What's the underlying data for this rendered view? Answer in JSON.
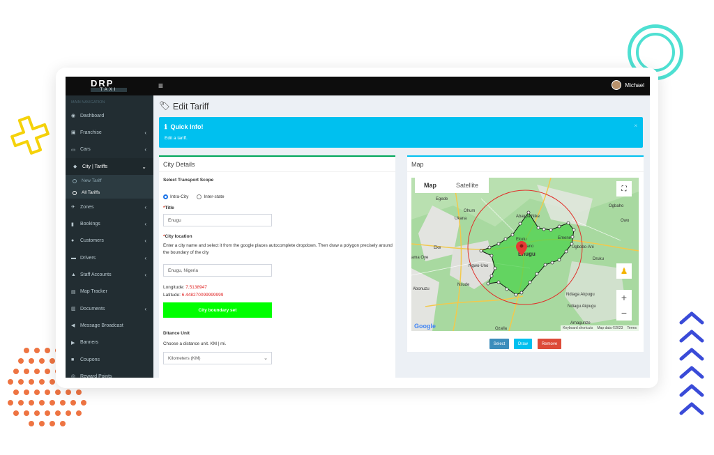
{
  "app": {
    "brand": "DRP",
    "brand_sub": "TAXI",
    "user_name": "Michael"
  },
  "sidebar": {
    "heading": "MAIN NAVIGATION",
    "items": [
      {
        "label": "Dashboard",
        "icon": "dashboard-icon",
        "chevron": ""
      },
      {
        "label": "Franchise",
        "icon": "briefcase-icon",
        "chevron": "‹"
      },
      {
        "label": "Cars",
        "icon": "car-icon",
        "chevron": "‹"
      },
      {
        "label": "City | Tariffs",
        "icon": "tags-icon",
        "chevron": "⌄"
      }
    ],
    "subitems": [
      {
        "label": "New Tariff"
      },
      {
        "label": "All Tariffs"
      }
    ],
    "items2": [
      {
        "label": "Zones",
        "icon": "plane-icon",
        "chevron": "‹"
      },
      {
        "label": "Bookings",
        "icon": "bookmark-icon",
        "chevron": "‹"
      },
      {
        "label": "Customers",
        "icon": "users-icon",
        "chevron": "‹"
      },
      {
        "label": "Drivers",
        "icon": "truck-icon",
        "chevron": "‹"
      },
      {
        "label": "Staff Accounts",
        "icon": "user-icon",
        "chevron": "‹"
      },
      {
        "label": "Map Tracker",
        "icon": "map-icon",
        "chevron": ""
      },
      {
        "label": "Documents",
        "icon": "book-icon",
        "chevron": "‹"
      },
      {
        "label": "Message Broadcast",
        "icon": "bullhorn-icon",
        "chevron": ""
      },
      {
        "label": "Banners",
        "icon": "flag-icon",
        "chevron": ""
      },
      {
        "label": "Coupons",
        "icon": "gift-icon",
        "chevron": ""
      },
      {
        "label": "Reward Points",
        "icon": "globe-icon",
        "chevron": ""
      }
    ]
  },
  "page": {
    "title": "Edit Tariff"
  },
  "info": {
    "title": "Quick Info!",
    "text": "Edit a tariff."
  },
  "city": {
    "title": "City Details",
    "scope_label": "Select Transport Scope",
    "scope_options": [
      "Intra-City",
      "Inter-state"
    ],
    "title_label": "Title",
    "title_value": "Enugu",
    "loc_label": "City location",
    "loc_help": "Enter a city name and select it from the google places autocomplete dropdown. Then draw a polygon precisely around the boundary of the city",
    "loc_value": "Enugu, Nigeria",
    "longitude_label": "Longitude:",
    "longitude": "7.5138947",
    "latitude_label": "Latitude:",
    "latitude": "6.448270099999999",
    "boundary_button": "City boundary set",
    "unit_label": "Ditance Unit",
    "unit_help": "Choose a distance unit. KM | mi.",
    "unit_value": "Kilometers (KM)"
  },
  "map": {
    "title": "Map",
    "mode_map": "Map",
    "mode_sat": "Satellite",
    "places": [
      "Egede",
      "Ohum",
      "Ukana",
      "Abakpa Nike",
      "Ogbaho",
      "Owo",
      "Ekulu",
      "Okinano",
      "Emene",
      "Ugbobo-Ani",
      "Enugu",
      "Druku",
      "Eke",
      "Ngwo-Uno",
      "ama Oye",
      "Nsude",
      "Abonuzu",
      "Ndiaga Akpugu",
      "Ozalla",
      "Amagunze",
      "Ndiagu Akpugu"
    ],
    "google": "Google",
    "attribution": [
      "Keyboard shortcuts",
      "Map data ©2023",
      "Terms"
    ],
    "buttons": {
      "select": "Select",
      "draw": "Draw",
      "remove": "Remove"
    }
  }
}
